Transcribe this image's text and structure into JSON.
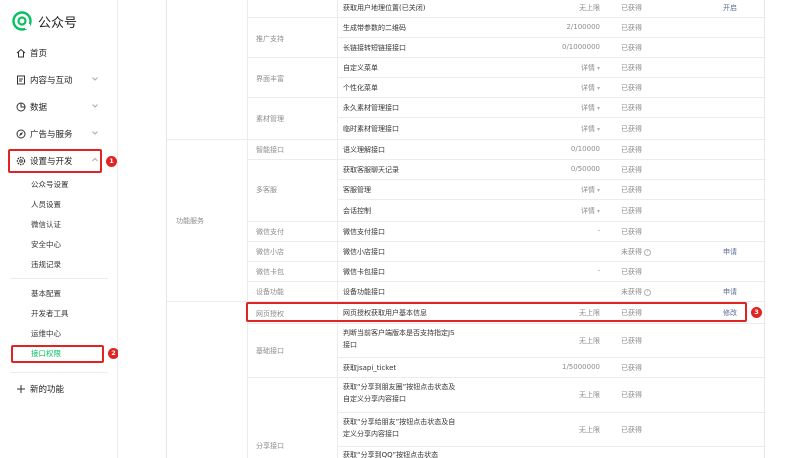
{
  "app": {
    "title": "公众号"
  },
  "nav": {
    "home": "首页",
    "content": "内容与互动",
    "data": "数据",
    "ads": "广告与服务",
    "settings": "设置与开发",
    "new": "新的功能"
  },
  "subnav": {
    "group1": [
      "公众号设置",
      "人员设置",
      "微信认证",
      "安全中心",
      "违规记录"
    ],
    "group2": [
      "基本配置",
      "开发者工具",
      "运维中心",
      "接口权限"
    ]
  },
  "badges": [
    "1",
    "2",
    "3"
  ],
  "section_label": "功能服务",
  "rows": {
    "r0": {
      "name": "获取用户地理位置(已关闭)",
      "quota": "无上限",
      "status": "已获得",
      "op": "开启"
    },
    "r1": {
      "name": "生成带参数的二维码",
      "quota": "2/100000",
      "status": "已获得"
    },
    "r2": {
      "name": "长链接转短链接接口",
      "quota": "0/1000000",
      "status": "已获得"
    },
    "r3": {
      "name": "自定义菜单",
      "quota": "详情",
      "status": "已获得"
    },
    "r4": {
      "name": "个性化菜单",
      "quota": "详情",
      "status": "已获得"
    },
    "r5": {
      "name": "永久素材管理接口",
      "quota": "详情",
      "status": "已获得"
    },
    "r6": {
      "name": "临时素材管理接口",
      "quota": "详情",
      "status": "已获得"
    },
    "r7": {
      "name": "语义理解接口",
      "quota": "0/10000",
      "status": "已获得"
    },
    "r8": {
      "name": "获取客服聊天记录",
      "quota": "0/50000",
      "status": "已获得"
    },
    "r9": {
      "name": "客服管理",
      "quota": "详情",
      "status": "已获得"
    },
    "r10": {
      "name": "会话控制",
      "quota": "详情",
      "status": "已获得"
    },
    "r11": {
      "name": "微信支付接口",
      "quota": "-",
      "status": "已获得"
    },
    "r12": {
      "name": "微信小店接口",
      "quota": "",
      "status": "未获得",
      "op": "申请"
    },
    "r13": {
      "name": "微信卡包接口",
      "quota": "-",
      "status": "已获得"
    },
    "r14": {
      "name": "设备功能接口",
      "quota": "",
      "status": "未获得",
      "op": "申请"
    },
    "r15": {
      "name": "网页授权获取用户基本信息",
      "quota": "无上限",
      "status": "已获得",
      "op": "修改"
    },
    "r16": {
      "name": "判断当前客户端版本是否支持指定JS接口",
      "quota": "无上限",
      "status": "已获得"
    },
    "r17": {
      "name": "获取jsapi_ticket",
      "quota": "1/5000000",
      "status": "已获得"
    },
    "r18": {
      "name": "获取“分享到朋友圈”按钮点击状态及自定义分享内容接口",
      "quota": "无上限",
      "status": "已获得"
    },
    "r19": {
      "name": "获取“分享给朋友”按钮点击状态及自定义分享内容接口",
      "quota": "无上限",
      "status": "已获得"
    },
    "r20": {
      "name": "获取“分享到QQ”按钮点击状态",
      "quota": "",
      "status": ""
    }
  },
  "categories": {
    "c1": "推广支持",
    "c2": "界面丰富",
    "c3": "素材管理",
    "c4": "智能接口",
    "c5": "多客服",
    "c6": "微信支付",
    "c7": "微信小店",
    "c8": "微信卡包",
    "c9": "设备功能",
    "c10": "网页授权",
    "c11": "基础接口",
    "c12": "分享接口"
  },
  "icons": {
    "logo": "wechat-mp-logo",
    "home": "home-icon",
    "content": "document-icon",
    "data": "chart-icon",
    "ads": "compass-icon",
    "settings": "gear-icon",
    "new": "plus-icon"
  },
  "colors": {
    "accent": "#07c160",
    "highlight": "#e02424",
    "link": "#576b95"
  }
}
